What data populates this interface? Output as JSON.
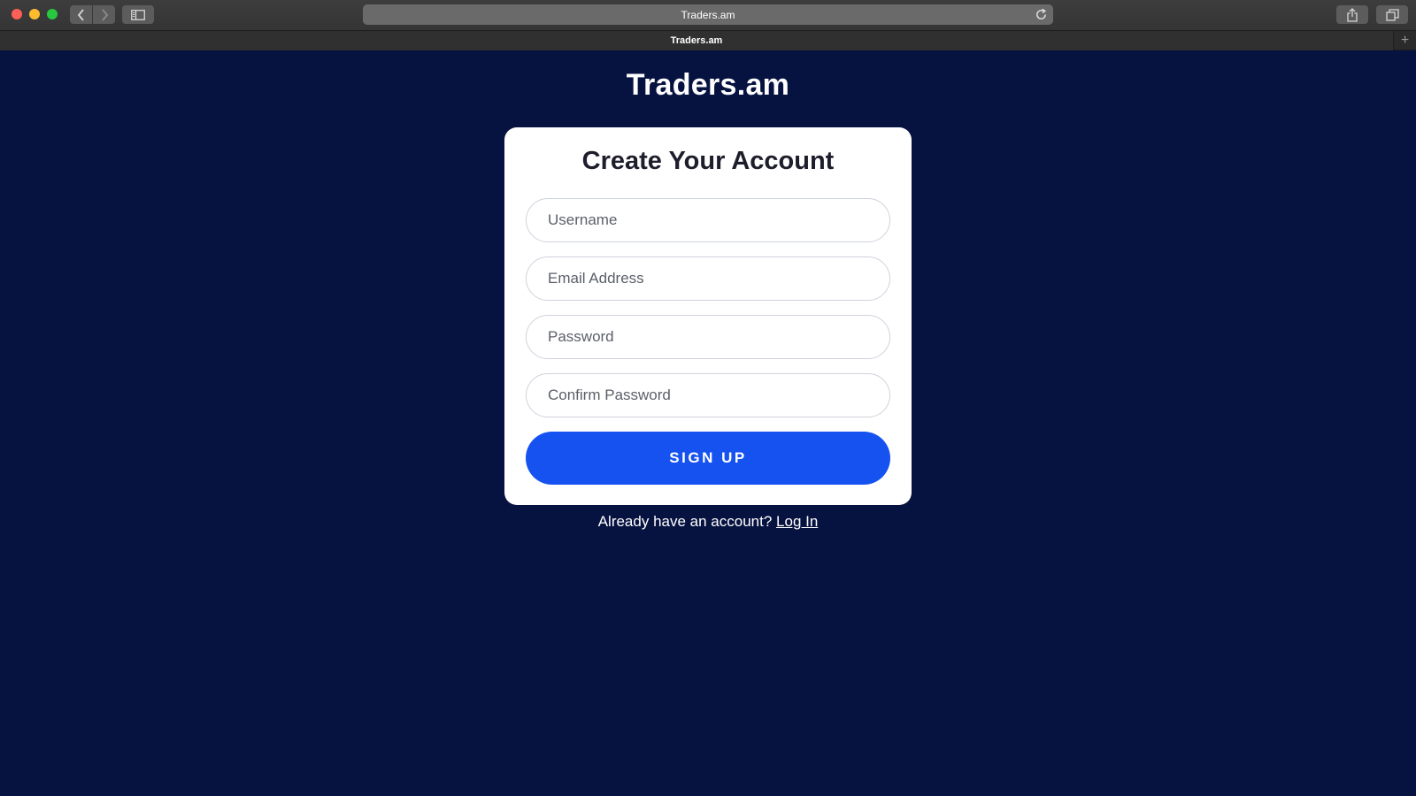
{
  "browser": {
    "address": "Traders.am",
    "tab_title": "Traders.am",
    "new_tab_label": "+"
  },
  "page": {
    "site_title": "Traders.am",
    "form": {
      "heading": "Create Your Account",
      "username_placeholder": "Username",
      "email_placeholder": "Email Address",
      "password_placeholder": "Password",
      "confirm_password_placeholder": "Confirm Password",
      "submit_label": "SIGN UP"
    },
    "login_prompt": "Already have an account?",
    "login_link": "Log In"
  },
  "colors": {
    "page_background": "#061340",
    "card_background": "#ffffff",
    "primary_button": "#1652f0"
  }
}
